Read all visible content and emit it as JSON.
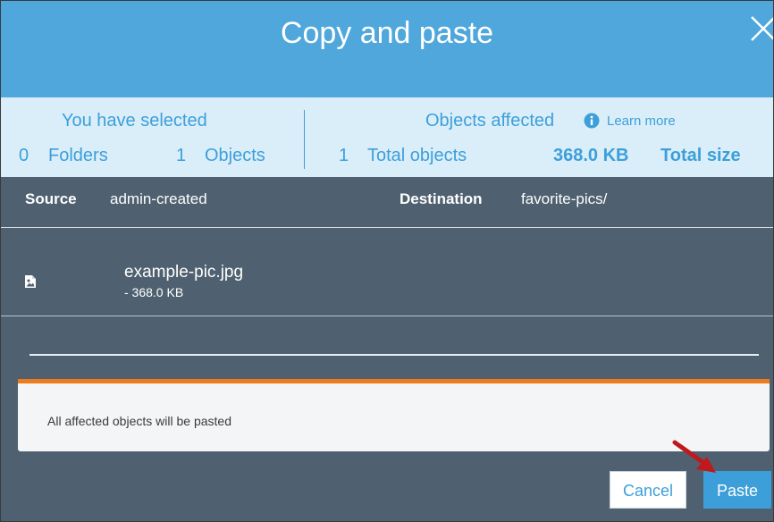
{
  "dialog": {
    "title": "Copy and paste"
  },
  "selected": {
    "heading": "You have selected",
    "folders_count": "0",
    "folders_label": "Folders",
    "objects_count": "1",
    "objects_label": "Objects"
  },
  "affected": {
    "heading": "Objects affected",
    "learn_more": "Learn more",
    "total_objects_count": "1",
    "total_objects_label": "Total objects",
    "total_size_value": "368.0 KB",
    "total_size_label": "Total size"
  },
  "source": {
    "label": "Source",
    "value": "admin-created"
  },
  "destination": {
    "label": "Destination",
    "value": "favorite-pics/"
  },
  "files": [
    {
      "name": "example-pic.jpg",
      "size": "- 368.0 KB",
      "icon": "image-file-icon"
    }
  ],
  "notice": {
    "text": "All affected objects will be pasted"
  },
  "footer": {
    "cancel_label": "Cancel",
    "paste_label": "Paste"
  },
  "colors": {
    "header": "#4fa7dc",
    "body": "#4f6170",
    "summary_bg": "#daeefa",
    "accent": "#3d9fd9",
    "notice_border": "#ef7c1c",
    "arrow": "#c0191d"
  }
}
